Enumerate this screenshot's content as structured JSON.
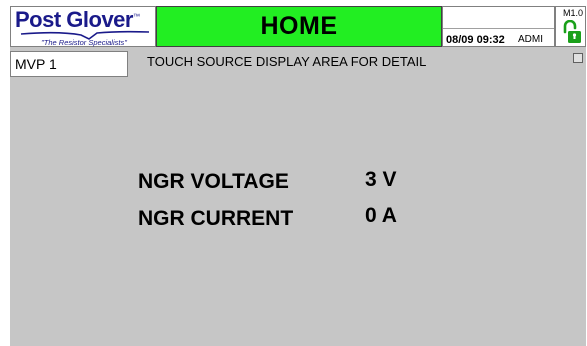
{
  "header": {
    "logo": {
      "brand": "Post Glover",
      "trademark": "™",
      "tagline": "\"The Resistor Specialists\""
    },
    "title": "HOME",
    "datetime": "08/09 09:32",
    "user": "ADMI",
    "version": "M1.0",
    "lock_icon": "unlocked-padlock-icon",
    "colors": {
      "title_bg": "#22ee22",
      "brand": "#1a1a8a",
      "lock": "#1aa01a"
    }
  },
  "source": {
    "selected": "MVP 1"
  },
  "instruction": "TOUCH SOURCE DISPLAY AREA FOR DETAIL",
  "readings": {
    "voltage": {
      "label": "NGR VOLTAGE",
      "value": "3 V"
    },
    "current": {
      "label": "NGR CURRENT",
      "value": "0 A"
    }
  },
  "screen_background": "#c6c6c6"
}
